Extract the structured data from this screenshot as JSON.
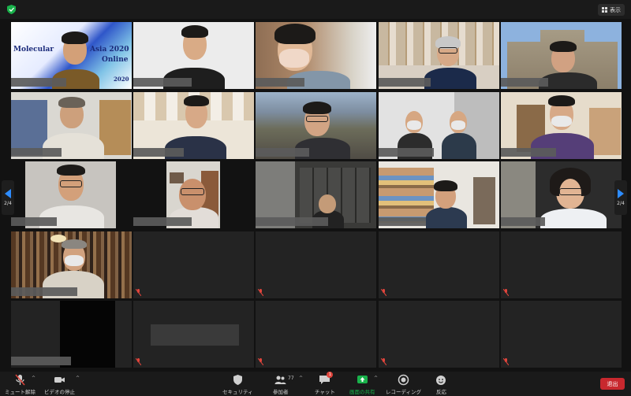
{
  "topbar": {
    "view_label": "表示"
  },
  "gallery": {
    "page_left": "2/4",
    "page_right": "2/4",
    "poster_lines": [
      "Molecular",
      "Asia 2020",
      "Online",
      "2020"
    ]
  },
  "toolbar": {
    "mute_label": "ミュート解除",
    "video_label": "ビデオの停止",
    "security_label": "セキュリティ",
    "participants_label": "参加者",
    "participants_count": "77",
    "chat_label": "チャット",
    "chat_badge": "1",
    "share_label": "画面の共有",
    "record_label": "レコーディング",
    "reactions_label": "反応",
    "end_label": "退出"
  },
  "colors": {
    "accent_green": "#19b24b",
    "end_red": "#c8282e",
    "pager_blue": "#2d8cff",
    "muted_red": "#e0453c"
  },
  "icons": [
    "shield-icon",
    "grid-icon",
    "mic-muted-icon",
    "camera-icon",
    "security-icon",
    "participants-icon",
    "chat-icon",
    "share-screen-icon",
    "record-icon",
    "reaction-icon"
  ]
}
